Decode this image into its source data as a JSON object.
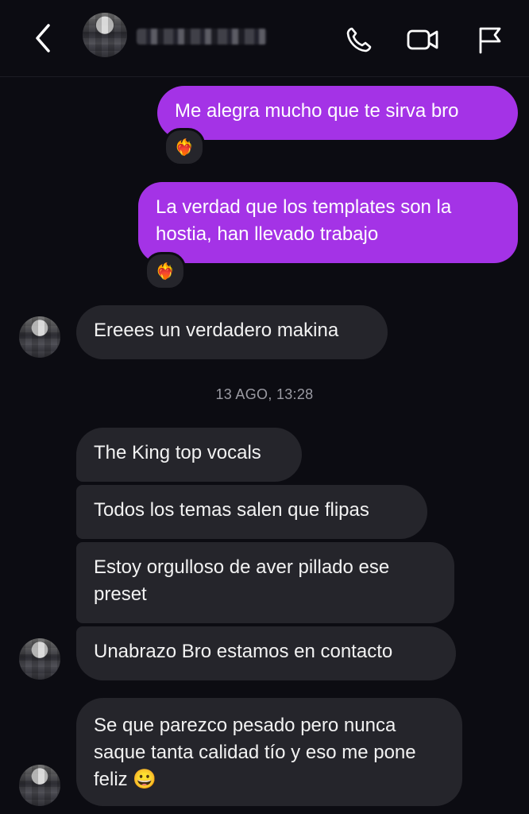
{
  "header": {
    "back_icon": "chevron-left-icon",
    "username": "",
    "actions": [
      {
        "icon": "phone-icon"
      },
      {
        "icon": "video-icon"
      },
      {
        "icon": "flag-icon"
      }
    ]
  },
  "messages": [
    {
      "text": "Me alegra mucho que te sirva bro",
      "from": "me",
      "reaction": "❤️‍🔥"
    },
    {
      "text": "La verdad que los templates son la hostia, han llevado trabajo",
      "from": "me",
      "reaction": "❤️‍🔥"
    },
    {
      "text": "Ereees un verdadero makina",
      "from": "them"
    },
    {
      "text": "The King top vocals",
      "from": "them"
    },
    {
      "text": "Todos los temas salen que flipas",
      "from": "them"
    },
    {
      "text": "Estoy orgulloso de aver pillado ese preset",
      "from": "them"
    },
    {
      "text": "Unabrazo Bro estamos en contacto",
      "from": "them"
    },
    {
      "text": "Se que parezco pesado pero nunca saque tanta calidad tío y eso me pone feliz 😀",
      "from": "them"
    }
  ],
  "timestamp": "13 AGO, 13:28",
  "colors": {
    "outgoing": "#a433e6",
    "incoming": "#25252b",
    "background": "#0c0c12"
  }
}
